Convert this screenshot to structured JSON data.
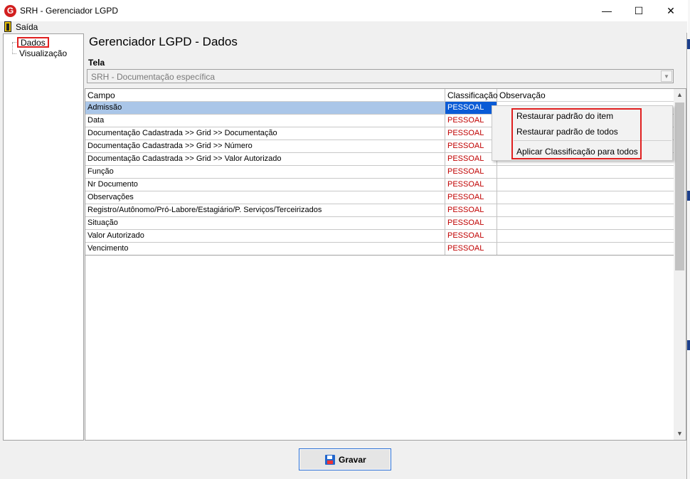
{
  "window": {
    "title": "SRH - Gerenciador LGPD",
    "minimize": "—",
    "maximize": "☐",
    "close": "✕"
  },
  "menu": {
    "exit_label": "Saída"
  },
  "tree": {
    "items": [
      {
        "label": "Dados",
        "selected": true
      },
      {
        "label": "Visualização",
        "selected": false
      }
    ]
  },
  "page": {
    "title": "Gerenciador LGPD - Dados",
    "tela_label": "Tela",
    "tela_value": "SRH - Documentação específica"
  },
  "grid": {
    "columns": [
      "Campo",
      "Classificação",
      "Observação"
    ],
    "rows": [
      {
        "campo": "Admissão",
        "classificacao": "PESSOAL",
        "observacao": ""
      },
      {
        "campo": "Data",
        "classificacao": "PESSOAL",
        "observacao": ""
      },
      {
        "campo": "Documentação Cadastrada >> Grid >> Documentação",
        "classificacao": "PESSOAL",
        "observacao": ""
      },
      {
        "campo": "Documentação Cadastrada >> Grid >> Número",
        "classificacao": "PESSOAL",
        "observacao": ""
      },
      {
        "campo": "Documentação Cadastrada >> Grid >> Valor Autorizado",
        "classificacao": "PESSOAL",
        "observacao": ""
      },
      {
        "campo": "Função",
        "classificacao": "PESSOAL",
        "observacao": ""
      },
      {
        "campo": "Nr Documento",
        "classificacao": "PESSOAL",
        "observacao": ""
      },
      {
        "campo": "Observações",
        "classificacao": "PESSOAL",
        "observacao": ""
      },
      {
        "campo": "Registro/Autônomo/Pró-Labore/Estagiário/P. Serviços/Terceirizados",
        "classificacao": "PESSOAL",
        "observacao": ""
      },
      {
        "campo": "Situação",
        "classificacao": "PESSOAL",
        "observacao": ""
      },
      {
        "campo": "Valor Autorizado",
        "classificacao": "PESSOAL",
        "observacao": ""
      },
      {
        "campo": "Vencimento",
        "classificacao": "PESSOAL",
        "observacao": ""
      }
    ]
  },
  "context_menu": {
    "items": [
      "Restaurar padrão do item",
      "Restaurar padrão de todos",
      "Aplicar Classificação para todos"
    ]
  },
  "actions": {
    "save_label": "Gravar"
  },
  "colors": {
    "classification_text": "#c00000",
    "selection": "#0a5bd6",
    "highlight_box": "#e02020"
  }
}
